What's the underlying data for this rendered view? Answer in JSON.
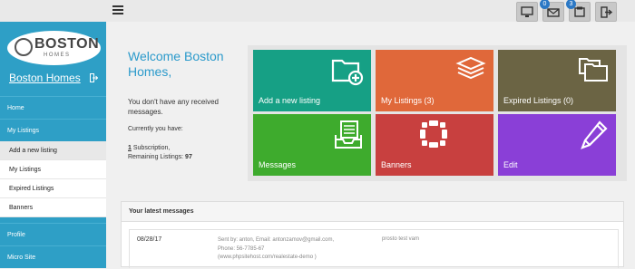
{
  "colors": {
    "sidebar": "#2e9fc6",
    "welcome": "#2b9acb",
    "tile_teal": "#16a085",
    "tile_orange": "#e0683a",
    "tile_olive": "#6b6444",
    "tile_green": "#3eab2d",
    "tile_red": "#c8403f",
    "tile_purple": "#8a3fd7"
  },
  "topbar": {
    "menu_icon": "hamburger-icon",
    "icons": [
      {
        "name": "monitor-icon",
        "badge": ""
      },
      {
        "name": "messages-icon",
        "badge": "0"
      },
      {
        "name": "listings-icon",
        "badge": "3"
      },
      {
        "name": "logout-icon",
        "badge": ""
      }
    ]
  },
  "brand": {
    "logo_name": "BOSTON",
    "logo_sub": "HOMES",
    "name": "Boston Homes"
  },
  "nav": {
    "home": "Home",
    "my_listings": "My Listings",
    "sub": [
      "Add a new listing",
      "My Listings",
      "Expired Listings",
      "Banners"
    ],
    "profile": "Profile",
    "micro_site": "Micro Site"
  },
  "welcome": {
    "title": "Welcome Boston Homes,",
    "no_messages": "You don't have any received messages.",
    "currently": "Currently you have:",
    "subscription_count": "1",
    "subscription_label": "Subscription,",
    "remaining_label": "Remaining Listings:",
    "remaining_value": "97"
  },
  "tiles": [
    {
      "label": "Add a new listing",
      "icon": "folder-add-icon"
    },
    {
      "label": "My Listings (3)",
      "icon": "stack-icon"
    },
    {
      "label": "Expired Listings (0)",
      "icon": "folders-icon"
    },
    {
      "label": "Messages",
      "icon": "inbox-icon"
    },
    {
      "label": "Banners",
      "icon": "banner-icon"
    },
    {
      "label": "Edit",
      "icon": "pencil-icon"
    }
  ],
  "messages": {
    "heading": "Your latest messages",
    "items": [
      {
        "date": "08/28/17",
        "from_line1": "Sent by: anton, Email: antonzamov@gmail.com,",
        "from_line2": "Phone: 56-7785-67",
        "from_line3": "(www.phpsitehost.com/realestate-demo )",
        "subject": "prosto test vam"
      }
    ]
  }
}
